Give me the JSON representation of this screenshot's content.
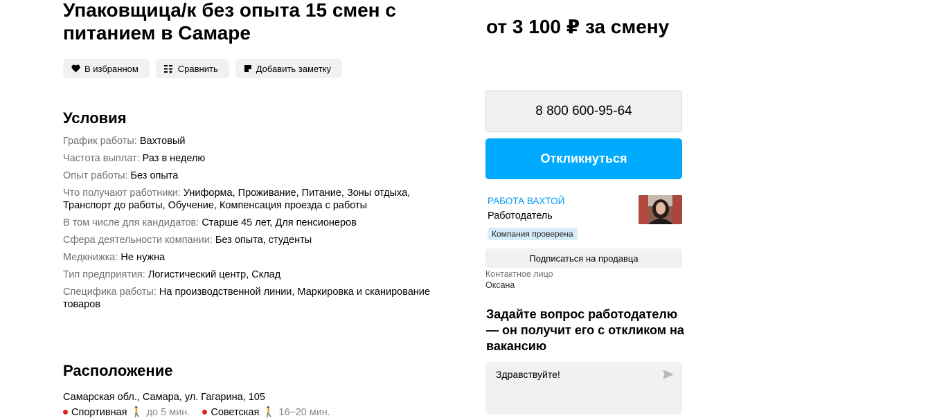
{
  "vacancy": {
    "title": "Упаковщица/к без опыта 15 смен с питанием в Самаре",
    "price": "от 3 100 ₽ за смену"
  },
  "actions": {
    "favorite_label": "В избранном",
    "compare_label": "Сравнить",
    "note_label": "Добавить заметку"
  },
  "conditions": {
    "heading": "Условия",
    "rows": [
      {
        "key": "График работы:",
        "value": "Вахтовый"
      },
      {
        "key": "Частота выплат:",
        "value": "Раз в неделю"
      },
      {
        "key": "Опыт работы:",
        "value": "Без опыта"
      },
      {
        "key": "Что получают работники:",
        "value": "Униформа, Проживание, Питание, Зоны отдыха, Транспорт до работы, Обучение, Компенсация проезда с работы"
      },
      {
        "key": "В том числе для кандидатов:",
        "value": "Старше 45 лет, Для пенсионеров"
      },
      {
        "key": "Сфера деятельности компании:",
        "value": "Без опыта, студенты"
      },
      {
        "key": "Медкнижка:",
        "value": "Не нужна"
      },
      {
        "key": "Тип предприятия:",
        "value": "Логистический центр, Склад"
      },
      {
        "key": "Специфика работы:",
        "value": "На производственной линии, Маркировка и сканирование товаров"
      }
    ]
  },
  "location": {
    "heading": "Расположение",
    "address": "Самарская обл., Самара, ул. Гагарина, 105",
    "metro": [
      {
        "station": "Спортивная",
        "walk": "до 5 мин."
      },
      {
        "station": "Советская",
        "walk": "16–20 мин."
      }
    ],
    "metro_color": "#e0201c"
  },
  "sidebar": {
    "phone": "8 800 600-95-64",
    "respond_label": "Откликнуться",
    "seller_name": "РАБОТА ВАХТОЙ",
    "seller_role": "Работодатель",
    "verified_badge": "Компания проверена",
    "subscribe_label": "Подписаться на продавца",
    "contact_label": "Контактное лицо",
    "contact_name": "Оксана",
    "ask_heading": "Задайте вопрос работодателю — он получит его с откликом на вакансию",
    "message_value": "Здравствуйте!",
    "accent_color": "#00aaff"
  },
  "icons": {
    "favorite": "heart-icon",
    "compare": "compare-icon",
    "note": "note-icon",
    "send": "send-icon",
    "walk": "walking-person-icon"
  }
}
